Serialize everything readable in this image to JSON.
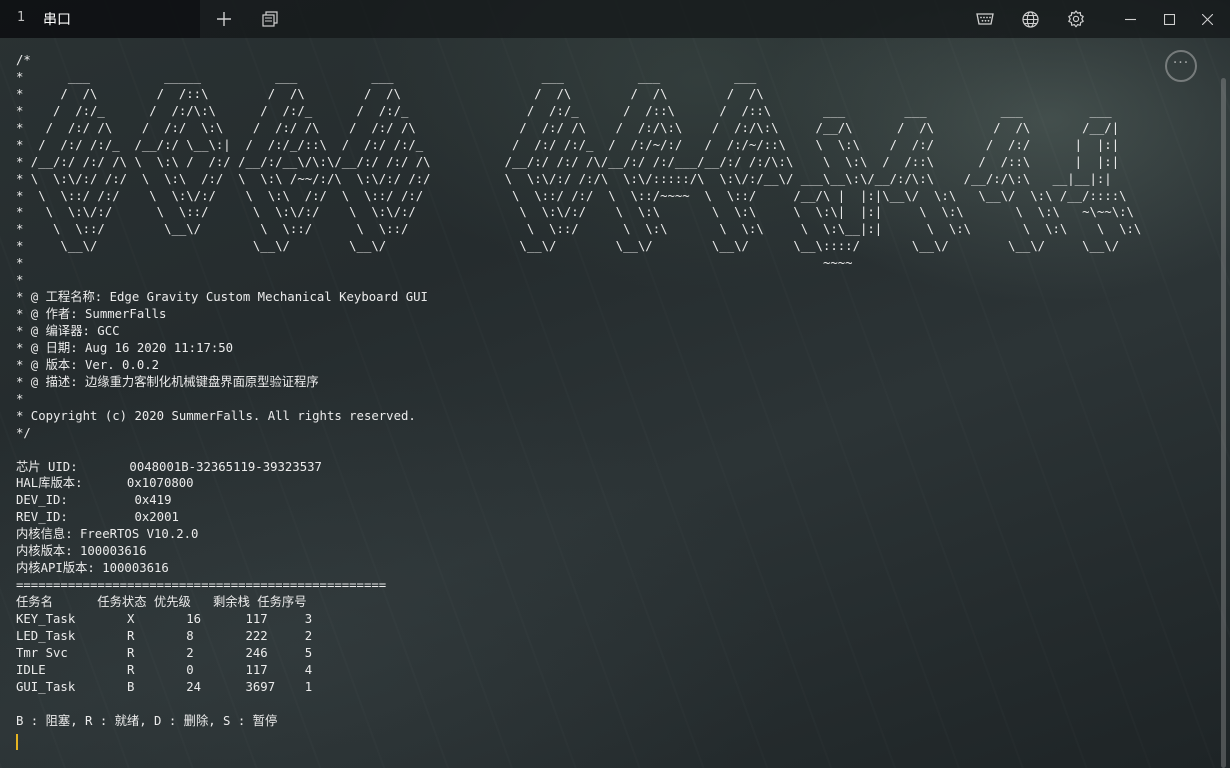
{
  "window": {
    "tab_index": "1",
    "tab_title": "串口",
    "add_tab_symbol": "+",
    "icons": [
      "plus-icon",
      "copy-windows-icon",
      "serial-port-icon",
      "globe-icon",
      "gear-icon",
      "minimize-icon",
      "maximize-icon",
      "close-icon"
    ],
    "accent_cursor_color": "#e6b422",
    "more_button_symbol": "···"
  },
  "terminal": {
    "lines": [
      "/*",
      "*      ___          _____          ___          ___                    ___          ___          ___",
      "*     /  /\\        /  /::\\        /  /\\        /  /\\                  /  /\\        /  /\\        /  /\\",
      "*    /  /:/_      /  /:/\\:\\      /  /:/_      /  /:/_                /  /:/_      /  /::\\      /  /::\\       ___        ___          ___         ___",
      "*   /  /:/ /\\    /  /:/  \\:\\    /  /:/ /\\    /  /:/ /\\              /  /:/ /\\    /  /:/\\:\\    /  /:/\\:\\     /__/\\      /  /\\        /  /\\       /__/|",
      "*  /  /:/ /:/_  /__/:/ \\__\\:|  /  /:/_/::\\  /  /:/ /:/_            /  /:/ /:/_  /  /:/~/:/   /  /:/~/::\\    \\  \\:\\    /  /:/       /  /:/      |  |:|",
      "* /__/:/ /:/ /\\ \\  \\:\\ /  /:/ /__/:/__\\/\\:\\/__/:/ /:/ /\\          /__/:/ /:/ /\\/__/:/ /:/___/__/:/ /:/\\:\\    \\  \\:\\  /  /::\\      /  /::\\      |  |:|",
      "* \\  \\:\\/:/ /:/  \\  \\:\\  /:/  \\  \\:\\ /~~/:/\\  \\:\\/:/ /:/          \\  \\:\\/:/ /:/\\  \\:\\/:::::/\\  \\:\\/:/__\\/ ___\\__\\:\\/__/:/\\:\\    /__/:/\\:\\   __|__|:|",
      "*  \\  \\::/ /:/    \\  \\:\\/:/    \\  \\:\\  /:/  \\  \\::/ /:/            \\  \\::/ /:/  \\  \\::/~~~~  \\  \\::/     /__/\\ |  |:|\\__\\/  \\:\\   \\__\\/  \\:\\ /__/::::\\",
      "*   \\  \\:\\/:/      \\  \\::/      \\  \\:\\/:/    \\  \\:\\/:/              \\  \\:\\/:/    \\  \\:\\       \\  \\:\\     \\  \\:\\|  |:|     \\  \\:\\       \\  \\:\\   ~\\~~\\:\\",
      "*    \\  \\::/        \\__\\/        \\  \\::/      \\  \\::/                \\  \\::/      \\  \\:\\       \\  \\:\\     \\  \\:\\__|:|      \\  \\:\\       \\  \\:\\    \\  \\:\\",
      "*     \\__\\/                     \\__\\/        \\__\\/                  \\__\\/        \\__\\/        \\__\\/      \\__\\::::/       \\__\\/        \\__\\/     \\__\\/",
      "*                                                                                                            ~~~~",
      "*",
      "* @ 工程名称: Edge Gravity Custom Mechanical Keyboard GUI",
      "* @ 作者: SummerFalls",
      "* @ 编译器: GCC",
      "* @ 日期: Aug 16 2020 11:17:50",
      "* @ 版本: Ver. 0.0.2",
      "* @ 描述: 边缘重力客制化机械键盘界面原型验证程序",
      "*",
      "* Copyright (c) 2020 SummerFalls. All rights reserved.",
      "*/",
      "",
      "芯片 UID:       0048001B-32365119-39323537",
      "HAL库版本:      0x1070800",
      "DEV_ID:         0x419",
      "REV_ID:         0x2001",
      "内核信息: FreeRTOS V10.2.0",
      "内核版本: 100003616",
      "内核API版本: 100003616",
      "==================================================",
      "任务名      任务状态 优先级   剩余栈 任务序号",
      "KEY_Task       X       16      117     3",
      "LED_Task       R       8       222     2",
      "Tmr Svc        R       2       246     5",
      "IDLE           R       0       117     4",
      "GUI_Task       B       24      3697    1",
      "",
      "B : 阻塞, R : 就绪, D : 删除, S : 暂停"
    ]
  }
}
